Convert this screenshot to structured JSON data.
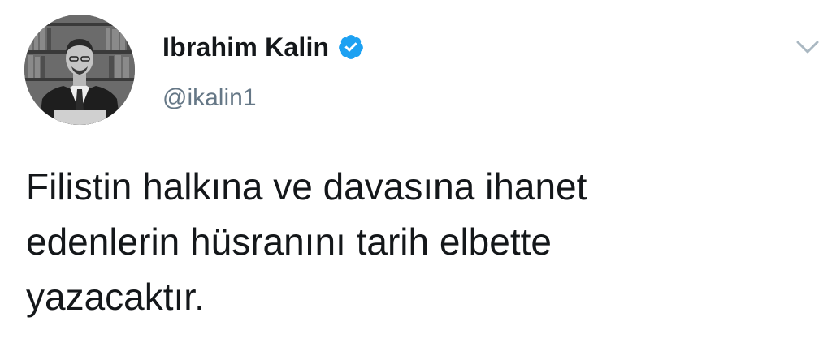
{
  "tweet": {
    "author": {
      "display_name": "Ibrahim Kalin",
      "handle": "@ikalin1",
      "verified": true
    },
    "text_lines": [
      "Filistin halkına ve davasına ihanet",
      "edenlerin hüsranını tarih elbette",
      "yazacaktır."
    ]
  },
  "icons": {
    "verified": "verified-badge-icon",
    "menu": "chevron-down-icon"
  },
  "colors": {
    "verified_blue": "#1da1f2",
    "text": "#14171a",
    "secondary": "#657786"
  }
}
